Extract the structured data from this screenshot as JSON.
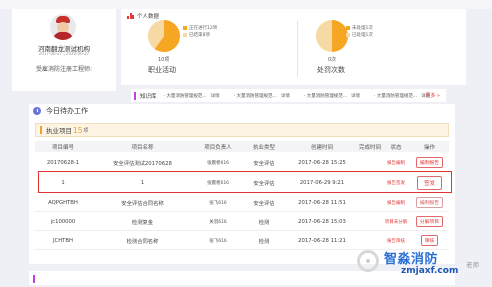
{
  "profile": {
    "org_name": "河南翻龙测试机构",
    "org_sub": "2017-06-27 | 2020-06-27",
    "engineer_label": "受雇消防注册工程师:"
  },
  "activity": {
    "title": "个人数据",
    "work": {
      "count": "10项",
      "caption": "职业活动",
      "legend": [
        "正在进行12项",
        "已结束8项"
      ],
      "fractions": [
        0.6,
        0.4
      ]
    },
    "punish": {
      "count": "0次",
      "caption": "处罚次数",
      "legend": [
        "未处理1次",
        "已处理1次"
      ],
      "fractions": [
        0.5,
        0.5
      ]
    },
    "colors": {
      "primary": "#f5a623",
      "secondary": "#f7d9a4"
    }
  },
  "knowledge": {
    "title": "知识库",
    "items": [
      {
        "text": "· 大量消防管理规范...",
        "detail": "详情"
      },
      {
        "text": "· 大量消防管理规范...",
        "detail": "详情"
      },
      {
        "text": "· 大量消防管理规范...",
        "detail": "详情"
      },
      {
        "text": "· 大量消防管理规范...",
        "detail": "详情"
      }
    ],
    "more": "更多 »"
  },
  "today": {
    "title": "今日待办工作",
    "projects_label": "执业项目",
    "projects_count": "15",
    "projects_unit": "项"
  },
  "table": {
    "headers": [
      "项目编号",
      "项目名称",
      "项目负责人",
      "执业类型",
      "创建时间",
      "完成时间",
      "状态",
      "操作"
    ],
    "rows": [
      {
        "id": "20170628-1",
        "name": "安全评估测试20170628",
        "lead": "张震者616",
        "type": "安全评估",
        "created": "2017-06-28 15:25",
        "done": "",
        "status": "报告编制",
        "action": "编制报告"
      },
      {
        "id": "1",
        "name": "1",
        "lead": "张震者616",
        "type": "安全评估",
        "created": "2017-06-29 9:21",
        "done": "",
        "status": "报告签发",
        "action": "签发"
      },
      {
        "id": "AQPGHTBH",
        "name": "安全评估合同名称",
        "lead": "张飞616",
        "type": "安全评估",
        "created": "2017-06-28 11:51",
        "done": "",
        "status": "报告编制",
        "action": "编制报告"
      },
      {
        "id": "jc100000",
        "name": "检测复金",
        "lead": "关羽616",
        "type": "检测",
        "created": "2017-06-28 15:03",
        "done": "",
        "status": "项目未分解",
        "action": "分解项目"
      },
      {
        "id": "JCHTBH",
        "name": "检测合同名称",
        "lead": "张飞616",
        "type": "检测",
        "created": "2017-06-28 11:21",
        "done": "",
        "status": "报告审核",
        "action": "审核"
      }
    ]
  },
  "watermark": {
    "title_a": "智淼消防",
    "sub": "zmjaxf.com",
    "side": "老师"
  }
}
